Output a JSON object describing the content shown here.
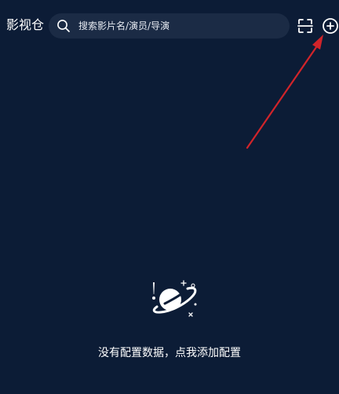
{
  "header": {
    "app_title": "影视仓",
    "search": {
      "placeholder": "搜索影片名/演员/导演",
      "value": ""
    },
    "icons": {
      "search": "search-icon",
      "scan": "scan-icon",
      "add": "add-circle-icon"
    }
  },
  "empty_state": {
    "icon": "planet-icon",
    "message": "没有配置数据，点我添加配置"
  },
  "colors": {
    "background": "#0c1c36",
    "search_background": "#1b2b45",
    "text": "#ffffff",
    "annotation_arrow": "#d1242a"
  }
}
